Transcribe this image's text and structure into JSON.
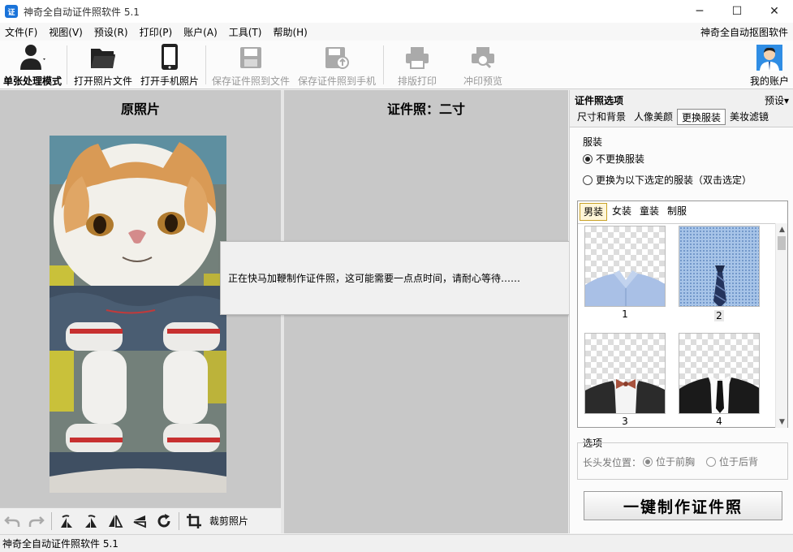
{
  "window": {
    "title": "神奇全自动证件照软件 5.1",
    "minimize": "─",
    "maximize": "☐",
    "close": "✕"
  },
  "menu": {
    "items": [
      "文件(F)",
      "视图(V)",
      "预设(R)",
      "打印(P)",
      "账户(A)",
      "工具(T)",
      "帮助(H)"
    ],
    "right_link": "神奇全自动抠图软件"
  },
  "toolbar": {
    "single_mode": "单张处理模式",
    "open_file": "打开照片文件",
    "open_phone": "打开手机照片",
    "save_file": "保存证件照到文件",
    "save_phone": "保存证件照到手机",
    "layout_print": "排版打印",
    "print_preview": "冲印预览",
    "my_account": "我的账户"
  },
  "left_panel": {
    "title": "原照片",
    "crop_label": "裁剪照片"
  },
  "mid_panel": {
    "title": "证件照：二寸"
  },
  "dialog": {
    "message": "正在快马加鞭制作证件照，这可能需要一点点时间，请耐心等待……"
  },
  "right_panel": {
    "header": "证件照选项",
    "preset": "预设▾",
    "tabs": [
      "尺寸和背景",
      "人像美颜",
      "更换服装",
      "美妆滤镜"
    ],
    "active_tab": 2,
    "clothing_group": "服装",
    "radio_no_change": "不更换服装",
    "radio_change": "更换为以下选定的服装（双击选定）",
    "cloth_tabs": [
      "男装",
      "女装",
      "童装",
      "制服"
    ],
    "active_cloth_tab": 0,
    "cloth_items": [
      "1",
      "2",
      "3",
      "4"
    ],
    "selected_cloth": "2",
    "options_group": "选项",
    "hair_label": "长头发位置：",
    "hair_front": "位于前胸",
    "hair_back": "位于后背",
    "make_button": "一键制作证件照"
  },
  "statusbar": {
    "text": "神奇全自动证件照软件 5.1"
  },
  "colors": {
    "panel_bg": "#c8c8c8",
    "accent_blue": "#1a73d9",
    "shirt_blue": "#a9c0e6"
  }
}
